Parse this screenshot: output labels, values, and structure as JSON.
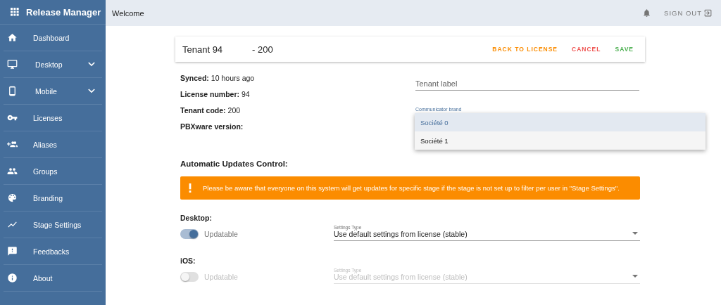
{
  "app": {
    "title": "Release Manager"
  },
  "sidebar": {
    "items": [
      {
        "label": "Dashboard",
        "expandable": false
      },
      {
        "label": "Desktop",
        "expandable": true
      },
      {
        "label": "Mobile",
        "expandable": true
      },
      {
        "label": "Licenses",
        "expandable": false
      },
      {
        "label": "Aliases",
        "expandable": false
      },
      {
        "label": "Groups",
        "expandable": false
      },
      {
        "label": "Branding",
        "expandable": false
      },
      {
        "label": "Stage Settings",
        "expandable": false
      },
      {
        "label": "Feedbacks",
        "expandable": false
      },
      {
        "label": "About",
        "expandable": false
      }
    ]
  },
  "header": {
    "title": "Welcome",
    "sign_out": "SIGN OUT"
  },
  "card": {
    "title": "Tenant 94",
    "code": "- 200",
    "actions": [
      {
        "label": "BACK TO LICENSE",
        "color": "#fb8c00"
      },
      {
        "label": "CANCEL",
        "color": "#ef5350"
      },
      {
        "label": "SAVE",
        "color": "#4caf50"
      }
    ]
  },
  "info": [
    {
      "label": "Synced:",
      "value": "10 hours ago"
    },
    {
      "label": "License number:",
      "value": "94"
    },
    {
      "label": "Tenant code:",
      "value": "200"
    },
    {
      "label": "PBXware version:"
    }
  ],
  "tenant_label": {
    "placeholder": "Tenant label"
  },
  "brand": {
    "label": "Communicator brand",
    "options": [
      {
        "label": "Société 0",
        "selected": true
      },
      {
        "label": "Société 1",
        "selected": false
      }
    ]
  },
  "updates": {
    "title": "Automatic Updates Control:",
    "warning": "Please be aware that everyone on this system will get updates for specific stage if the stage is not set up to filter per user in \"Stage Settings\".",
    "platforms": [
      {
        "name": "Desktop:",
        "toggle_label": "Updatable",
        "on": true,
        "disabled": false,
        "settings_label": "Settings Type",
        "settings_value": "Use default settings from license (stable)"
      },
      {
        "name": "iOS:",
        "toggle_label": "Updatable",
        "on": false,
        "disabled": true,
        "settings_label": "Settings Type",
        "settings_value": "Use default settings from license (stable)"
      }
    ]
  }
}
